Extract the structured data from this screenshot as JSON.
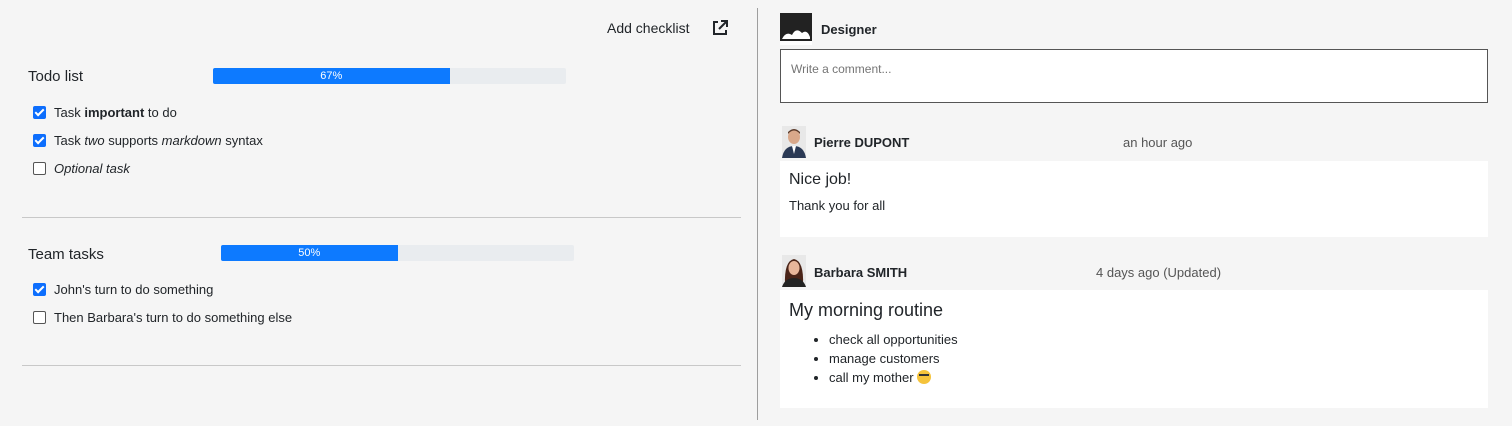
{
  "toolbar": {
    "add_checklist": "Add checklist"
  },
  "checklists": [
    {
      "title": "Todo list",
      "progress": 67,
      "progress_label": "67%",
      "tasks": [
        {
          "text_pre": "Task ",
          "text_bold": "important",
          "text_post": " to do",
          "checked": true
        },
        {
          "text_pre": "Task ",
          "text_italic": "two",
          "text_mid": " supports ",
          "text_italic2": "markdown",
          "text_post": " syntax",
          "checked": true
        },
        {
          "text_italic": "Optional task",
          "checked": false
        }
      ]
    },
    {
      "title": "Team tasks",
      "progress": 50,
      "progress_label": "50%",
      "tasks": [
        {
          "text": "John's turn to do something",
          "checked": true
        },
        {
          "text": "Then Barbara's turn to do something else",
          "checked": false
        }
      ]
    }
  ],
  "current_user": {
    "name": "Designer",
    "comment_placeholder": "Write a comment..."
  },
  "comments": [
    {
      "author": "Pierre DUPONT",
      "time": "an hour ago",
      "title": "Nice job!",
      "body": "Thank you for all"
    },
    {
      "author": "Barbara SMITH",
      "time": "4 days ago (Updated)",
      "title": "My morning routine",
      "items": [
        "check all opportunities",
        "manage customers",
        "call my mother"
      ]
    }
  ],
  "colors": {
    "progress": "#0d7aff",
    "checkbox": "#0d6efd"
  },
  "icons": {
    "external": "external-link-icon"
  }
}
